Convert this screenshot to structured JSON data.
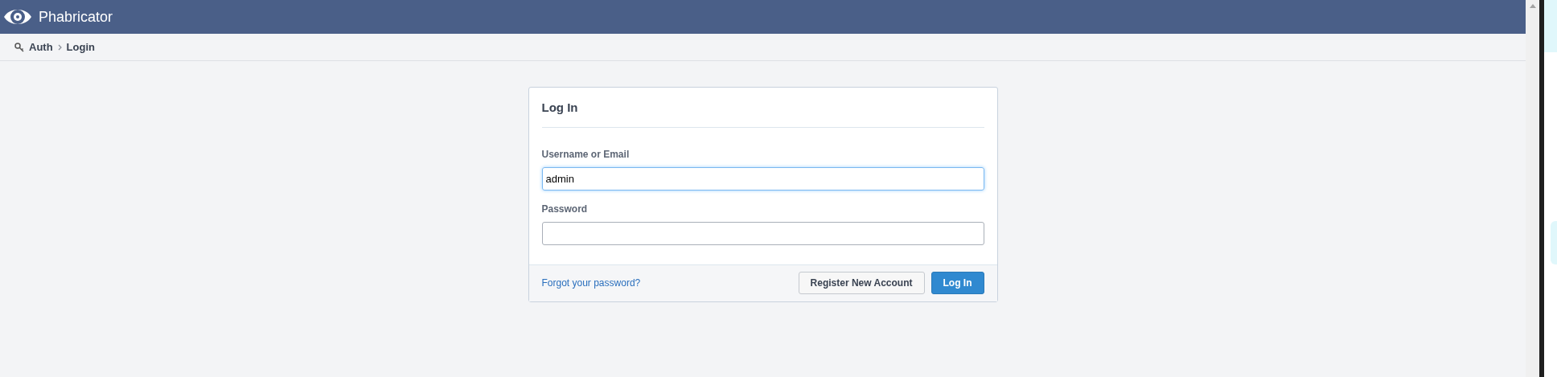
{
  "header": {
    "brand": "Phabricator"
  },
  "breadcrumbs": [
    {
      "label": "Auth"
    },
    {
      "label": "Login"
    }
  ],
  "login": {
    "title": "Log In",
    "fields": [
      {
        "label": "Username or Email",
        "value": "admin",
        "focused": true
      },
      {
        "label": "Password",
        "focused": false
      }
    ],
    "forgot_link": "Forgot your password?",
    "buttons": [
      {
        "label": "Register New Account",
        "kind": "secondary"
      },
      {
        "label": "Log In",
        "kind": "primary"
      }
    ]
  }
}
